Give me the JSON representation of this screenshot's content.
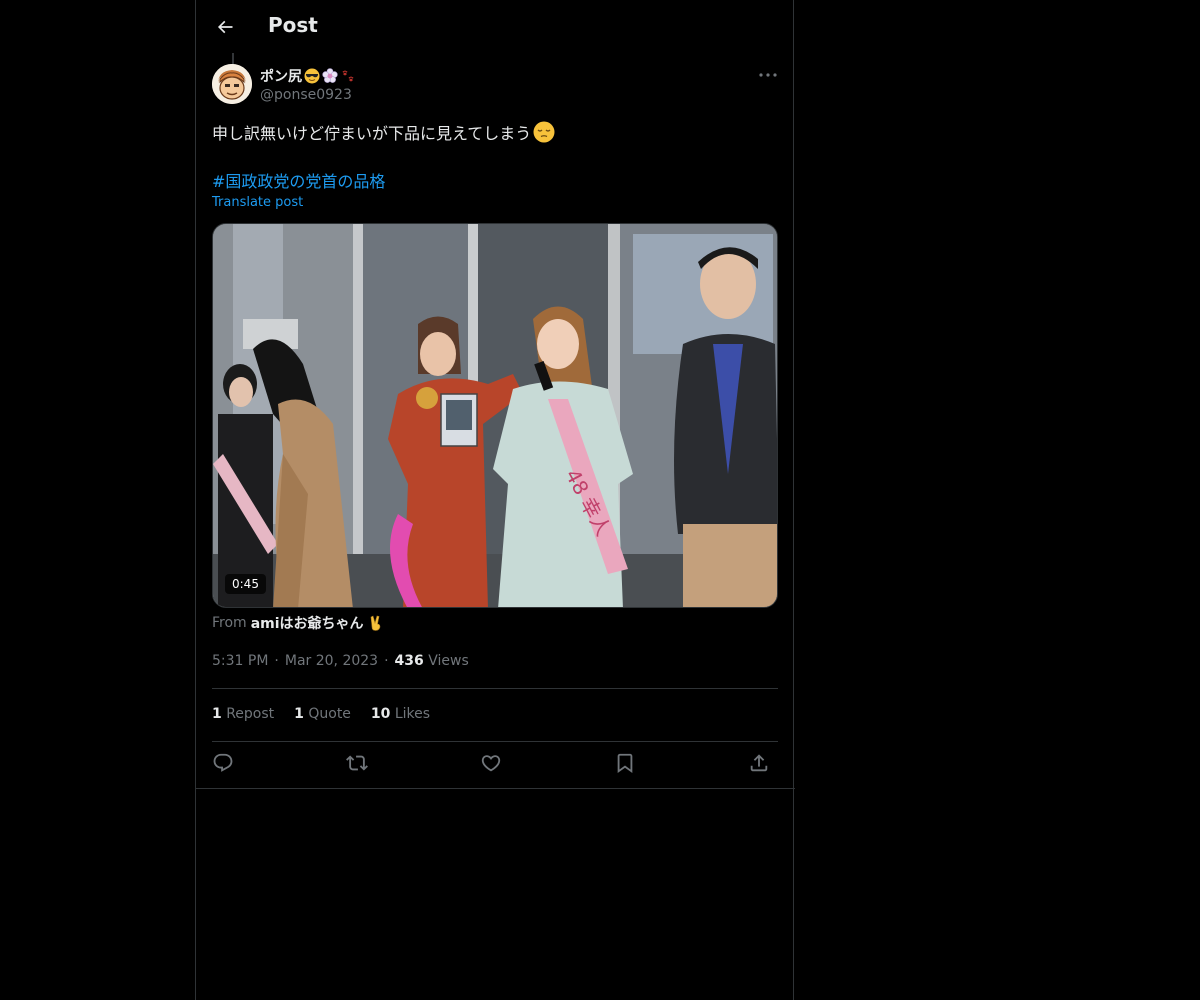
{
  "header": {
    "title": "Post"
  },
  "author": {
    "display_name": "ポン尻",
    "handle": "@ponse0923"
  },
  "post": {
    "text": "申し訳無いけど佇まいが下品に見えてしまう",
    "hashtag": "#国政政党の党首の品格",
    "translate_label": "Translate post"
  },
  "video": {
    "duration": "0:45",
    "sash_text": "48 幸人"
  },
  "source": {
    "from_label": "From",
    "name": "amiはお爺ちゃん"
  },
  "meta": {
    "time": "5:31 PM",
    "sep": "·",
    "date": "Mar 20, 2023",
    "views_count": "436",
    "views_label": "Views"
  },
  "stats": {
    "reposts_count": "1",
    "reposts_label": "Repost",
    "quotes_count": "1",
    "quotes_label": "Quote",
    "likes_count": "10",
    "likes_label": "Likes"
  },
  "icons": [
    "back-arrow-icon",
    "more-icon",
    "reply-icon",
    "repost-icon",
    "like-icon",
    "bookmark-icon",
    "share-icon"
  ],
  "colors": {
    "background": "#000000",
    "text": "#e7e9ea",
    "secondary": "#71767b",
    "link": "#1d9bf0",
    "border": "#2f3336"
  }
}
